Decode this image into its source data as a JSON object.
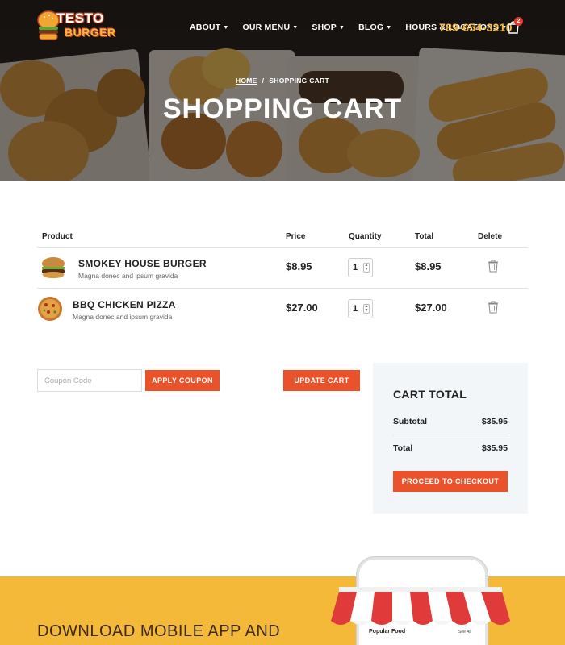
{
  "brand": {
    "logo_line1": "TESTO",
    "logo_line2": "BURGER",
    "phone": "789-654-3210",
    "cart_count": "2"
  },
  "nav": {
    "items": [
      {
        "label": "ABOUT"
      },
      {
        "label": "OUR MENU"
      },
      {
        "label": "SHOP"
      },
      {
        "label": "BLOG"
      },
      {
        "label": "HOURS & LOCATIONS"
      }
    ]
  },
  "hero": {
    "breadcrumb_home": "HOME",
    "breadcrumb_separator": "/",
    "breadcrumb_current": "SHOPPING CART",
    "title": "SHOPPING CART"
  },
  "cart": {
    "headers": {
      "product": "Product",
      "price": "Price",
      "quantity": "Quantity",
      "total": "Total",
      "delete": "Delete"
    },
    "items": [
      {
        "name": "SMOKEY HOUSE BURGER",
        "description": "Magna donec and ipsum gravida",
        "price": "$8.95",
        "quantity": "1",
        "total": "$8.95",
        "image": "burger-image"
      },
      {
        "name": "BBQ CHICKEN PIZZA",
        "description": "Magna donec and ipsum gravida",
        "price": "$27.00",
        "quantity": "1",
        "total": "$27.00",
        "image": "pizza-image"
      }
    ]
  },
  "coupon": {
    "placeholder": "Coupon Code",
    "value": "",
    "apply_label": "APPLY COUPON",
    "update_label": "UPDATE CART"
  },
  "totals": {
    "title": "CART TOTAL",
    "subtotal_label": "Subtotal",
    "subtotal_value": "$35.95",
    "total_label": "Total",
    "total_value": "$35.95",
    "checkout_label": "PROCEED TO CHECKOUT"
  },
  "app_banner": {
    "title": "DOWNLOAD MOBILE APP AND",
    "phone_section_title": "Popular Food",
    "phone_see_all": "See All"
  },
  "colors": {
    "accent": "#e9522b",
    "phone_yellow": "#f5b840",
    "banner_yellow": "#f5b93a",
    "totals_bg": "#f3f6f8"
  }
}
